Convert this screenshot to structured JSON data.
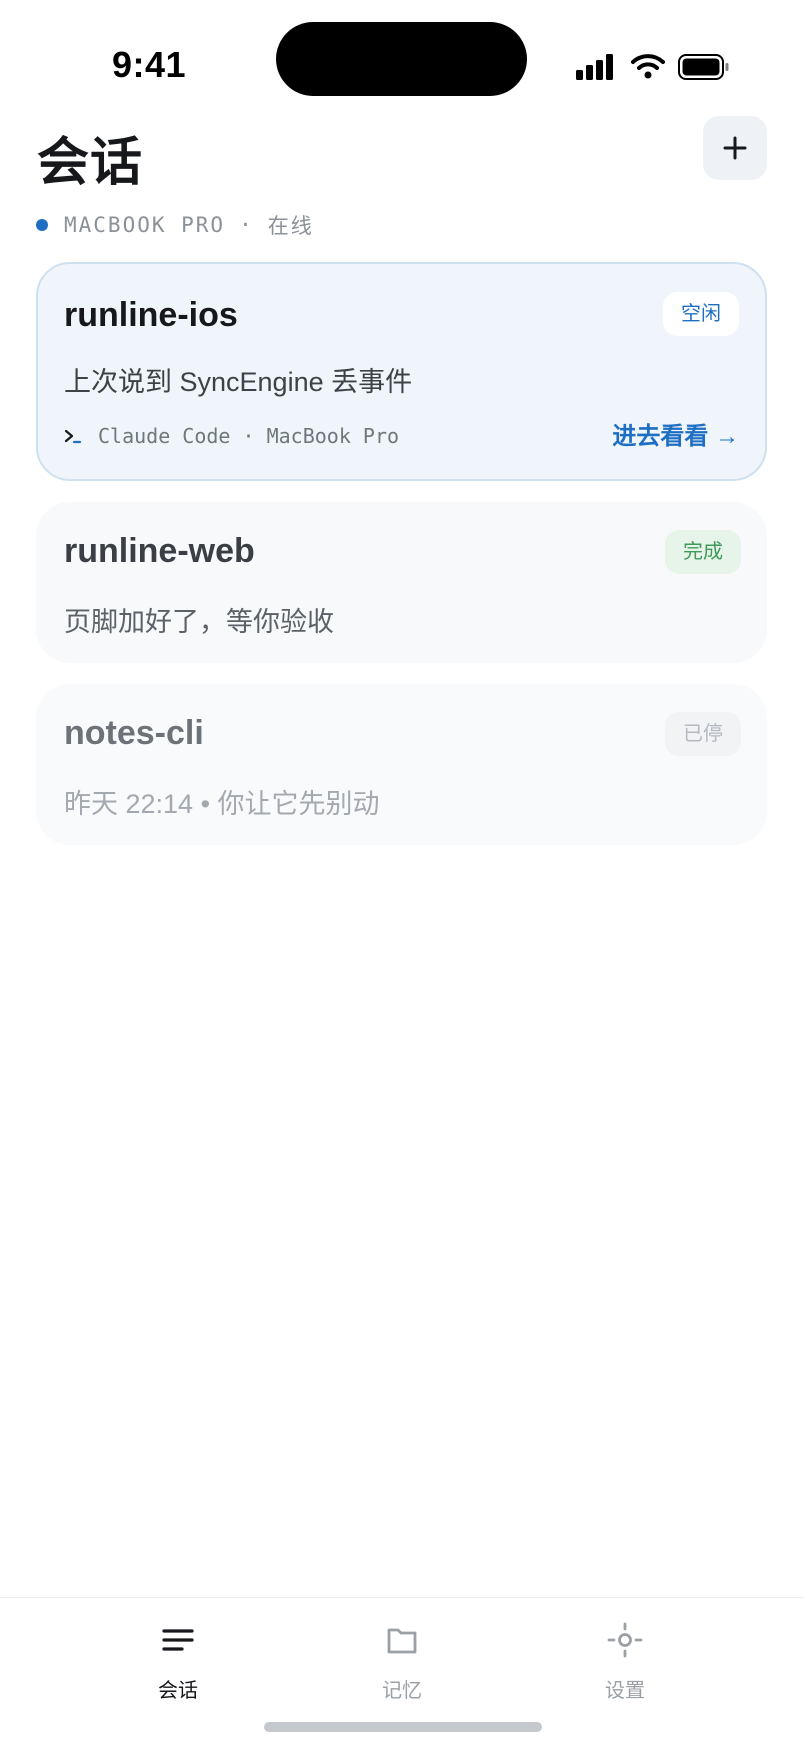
{
  "status_bar": {
    "time": "9:41"
  },
  "header": {
    "title": "会话",
    "add_label": "+"
  },
  "device": {
    "name": "MACBOOK PRO",
    "separator": "·",
    "status": "在线",
    "status_color": "#1e6fc4"
  },
  "sessions": [
    {
      "title": "runline-ios",
      "badge": "空闲",
      "description": "上次说到 SyncEngine 丢事件",
      "meta": "Claude Code · MacBook Pro",
      "action": "进去看看 →"
    },
    {
      "title": "runline-web",
      "badge": "完成",
      "description": "页脚加好了，等你验收"
    },
    {
      "title": "notes-cli",
      "badge": "已停",
      "description": "昨天 22:14 • 你让它先别动"
    }
  ],
  "tabs": [
    {
      "label": "会话",
      "icon": "menu-icon",
      "active": true
    },
    {
      "label": "记忆",
      "icon": "folder-icon",
      "active": false
    },
    {
      "label": "设置",
      "icon": "settings-icon",
      "active": false
    }
  ],
  "colors": {
    "accent": "#1e6fc4",
    "done_green": "#3f9a5a",
    "active_card_bg": "#eff5fb"
  }
}
